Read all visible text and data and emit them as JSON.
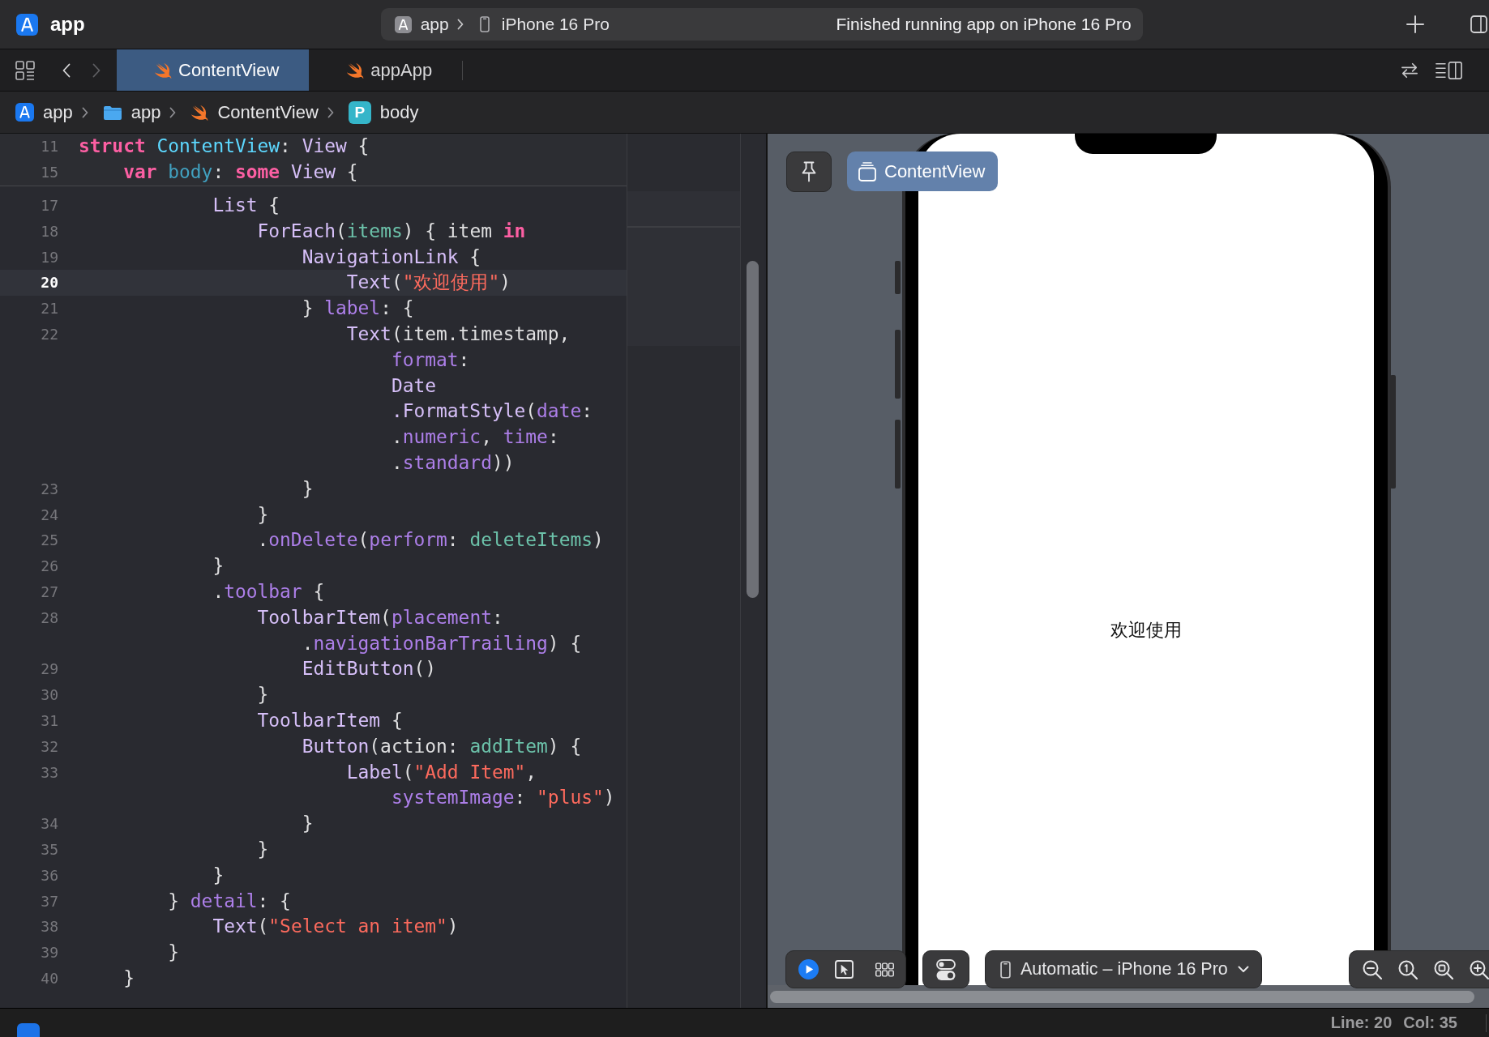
{
  "title_bar": {
    "app_name": "app",
    "scheme": {
      "project": "app",
      "device": "iPhone 16 Pro"
    },
    "activity": "Finished running app on iPhone 16 Pro"
  },
  "tab_bar": {
    "nav_buttons": [
      {
        "kind": "back",
        "disabled": false
      },
      {
        "kind": "forward",
        "disabled": true
      }
    ],
    "tabs": [
      {
        "label": "ContentView",
        "selected": true
      },
      {
        "label": "appApp",
        "selected": false
      }
    ]
  },
  "breadcrumb": [
    {
      "kind": "project",
      "label": "app"
    },
    {
      "kind": "folder",
      "label": "app"
    },
    {
      "kind": "file",
      "label": "ContentView"
    },
    {
      "kind": "symbol",
      "badge": "P",
      "label": "body"
    }
  ],
  "editor": {
    "sticky_lines": [
      {
        "number": "11",
        "tokens": [
          {
            "text": "struct ",
            "kind": "keyword"
          },
          {
            "text": "ContentView",
            "kind": "type_decl"
          },
          {
            "text": ": ",
            "kind": "plain"
          },
          {
            "text": "View",
            "kind": "type"
          },
          {
            "text": " {",
            "kind": "plain"
          }
        ]
      },
      {
        "number": "15",
        "tokens": [
          {
            "text": "    var ",
            "kind": "keyword"
          },
          {
            "text": "body",
            "kind": "decl"
          },
          {
            "text": ": ",
            "kind": "plain"
          },
          {
            "text": "some ",
            "kind": "keyword"
          },
          {
            "text": "View",
            "kind": "type"
          },
          {
            "text": " {",
            "kind": "plain"
          }
        ]
      }
    ],
    "lines": [
      {
        "number": "17",
        "current": false,
        "tokens": [
          {
            "text": "            List",
            "kind": "type"
          },
          {
            "text": " {",
            "kind": "plain"
          }
        ]
      },
      {
        "number": "18",
        "current": false,
        "tokens": [
          {
            "text": "                ForEach",
            "kind": "type"
          },
          {
            "text": "(",
            "kind": "plain"
          },
          {
            "text": "items",
            "kind": "project"
          },
          {
            "text": ") { item ",
            "kind": "plain"
          },
          {
            "text": "in",
            "kind": "keyword"
          }
        ]
      },
      {
        "number": "19",
        "current": false,
        "tokens": [
          {
            "text": "                    NavigationLink",
            "kind": "type"
          },
          {
            "text": " {",
            "kind": "plain"
          }
        ]
      },
      {
        "number": "20",
        "current": true,
        "tokens": [
          {
            "text": "                        Text",
            "kind": "type"
          },
          {
            "text": "(",
            "kind": "plain"
          },
          {
            "text": "\"欢迎使用\"",
            "kind": "string"
          },
          {
            "text": ")",
            "kind": "plain"
          }
        ]
      },
      {
        "number": "21",
        "current": false,
        "tokens": [
          {
            "text": "                    } ",
            "kind": "plain"
          },
          {
            "text": "label",
            "kind": "member"
          },
          {
            "text": ": {",
            "kind": "plain"
          }
        ]
      },
      {
        "number": "22",
        "current": false,
        "tokens": [
          {
            "text": "                        Text",
            "kind": "type"
          },
          {
            "text": "(item.timestamp,",
            "kind": "plain"
          },
          {
            "text": "\n                            format",
            "kind": "member"
          },
          {
            "text": ":",
            "kind": "plain"
          },
          {
            "text": "\n                            Date",
            "kind": "type"
          },
          {
            "text": "\n                            .FormatStyle",
            "kind": "type"
          },
          {
            "text": "(",
            "kind": "plain"
          },
          {
            "text": "date",
            "kind": "member"
          },
          {
            "text": ":",
            "kind": "plain"
          },
          {
            "text": "\n                            .",
            "kind": "plain"
          },
          {
            "text": "numeric",
            "kind": "member"
          },
          {
            "text": ", ",
            "kind": "plain"
          },
          {
            "text": "time",
            "kind": "member"
          },
          {
            "text": ":",
            "kind": "plain"
          },
          {
            "text": "\n                            .",
            "kind": "plain"
          },
          {
            "text": "standard",
            "kind": "member"
          },
          {
            "text": "))",
            "kind": "plain"
          }
        ]
      },
      {
        "number": "23",
        "current": false,
        "tokens": [
          {
            "text": "                    }",
            "kind": "plain"
          }
        ]
      },
      {
        "number": "24",
        "current": false,
        "tokens": [
          {
            "text": "                }",
            "kind": "plain"
          }
        ]
      },
      {
        "number": "25",
        "current": false,
        "tokens": [
          {
            "text": "                .",
            "kind": "plain"
          },
          {
            "text": "onDelete",
            "kind": "member"
          },
          {
            "text": "(",
            "kind": "plain"
          },
          {
            "text": "perform",
            "kind": "member"
          },
          {
            "text": ": ",
            "kind": "plain"
          },
          {
            "text": "deleteItems",
            "kind": "project"
          },
          {
            "text": ")",
            "kind": "plain"
          }
        ]
      },
      {
        "number": "26",
        "current": false,
        "tokens": [
          {
            "text": "            }",
            "kind": "plain"
          }
        ]
      },
      {
        "number": "27",
        "current": false,
        "tokens": [
          {
            "text": "            .",
            "kind": "plain"
          },
          {
            "text": "toolbar",
            "kind": "member"
          },
          {
            "text": " {",
            "kind": "plain"
          }
        ]
      },
      {
        "number": "28",
        "current": false,
        "tokens": [
          {
            "text": "                ToolbarItem",
            "kind": "type"
          },
          {
            "text": "(",
            "kind": "plain"
          },
          {
            "text": "placement",
            "kind": "member"
          },
          {
            "text": ":",
            "kind": "plain"
          },
          {
            "text": "\n                    .",
            "kind": "plain"
          },
          {
            "text": "navigationBarTrailing",
            "kind": "member"
          },
          {
            "text": ") {",
            "kind": "plain"
          }
        ]
      },
      {
        "number": "29",
        "current": false,
        "tokens": [
          {
            "text": "                    EditButton",
            "kind": "type"
          },
          {
            "text": "()",
            "kind": "plain"
          }
        ]
      },
      {
        "number": "30",
        "current": false,
        "tokens": [
          {
            "text": "                }",
            "kind": "plain"
          }
        ]
      },
      {
        "number": "31",
        "current": false,
        "tokens": [
          {
            "text": "                ToolbarItem",
            "kind": "type"
          },
          {
            "text": " {",
            "kind": "plain"
          }
        ]
      },
      {
        "number": "32",
        "current": false,
        "tokens": [
          {
            "text": "                    Button",
            "kind": "type"
          },
          {
            "text": "(action: ",
            "kind": "plain"
          },
          {
            "text": "addItem",
            "kind": "project"
          },
          {
            "text": ") {",
            "kind": "plain"
          }
        ]
      },
      {
        "number": "33",
        "current": false,
        "tokens": [
          {
            "text": "                        Label",
            "kind": "type"
          },
          {
            "text": "(",
            "kind": "plain"
          },
          {
            "text": "\"Add Item\"",
            "kind": "string"
          },
          {
            "text": ",",
            "kind": "plain"
          },
          {
            "text": "\n                            systemImage",
            "kind": "member"
          },
          {
            "text": ": ",
            "kind": "plain"
          },
          {
            "text": "\"plus\"",
            "kind": "string"
          },
          {
            "text": ")",
            "kind": "plain"
          }
        ]
      },
      {
        "number": "34",
        "current": false,
        "tokens": [
          {
            "text": "                    }",
            "kind": "plain"
          }
        ]
      },
      {
        "number": "35",
        "current": false,
        "tokens": [
          {
            "text": "                }",
            "kind": "plain"
          }
        ]
      },
      {
        "number": "36",
        "current": false,
        "tokens": [
          {
            "text": "            }",
            "kind": "plain"
          }
        ]
      },
      {
        "number": "37",
        "current": false,
        "tokens": [
          {
            "text": "        } ",
            "kind": "plain"
          },
          {
            "text": "detail",
            "kind": "member"
          },
          {
            "text": ": {",
            "kind": "plain"
          }
        ]
      },
      {
        "number": "38",
        "current": false,
        "tokens": [
          {
            "text": "            Text",
            "kind": "type"
          },
          {
            "text": "(",
            "kind": "plain"
          },
          {
            "text": "\"Select an item\"",
            "kind": "string"
          },
          {
            "text": ")",
            "kind": "plain"
          }
        ]
      },
      {
        "number": "39",
        "current": false,
        "tokens": [
          {
            "text": "        }",
            "kind": "plain"
          }
        ]
      },
      {
        "number": "40",
        "current": false,
        "tokens": [
          {
            "text": "    }",
            "kind": "plain"
          }
        ]
      }
    ]
  },
  "preview": {
    "title": "ContentView",
    "screen_text": "欢迎使用",
    "modes": [
      {
        "kind": "live",
        "selected": true
      },
      {
        "kind": "select",
        "selected": false
      }
    ],
    "device_menu": "Automatic – iPhone 16 Pro"
  },
  "status_bar": {
    "line": "Line: 20",
    "column": "Col: 35"
  }
}
